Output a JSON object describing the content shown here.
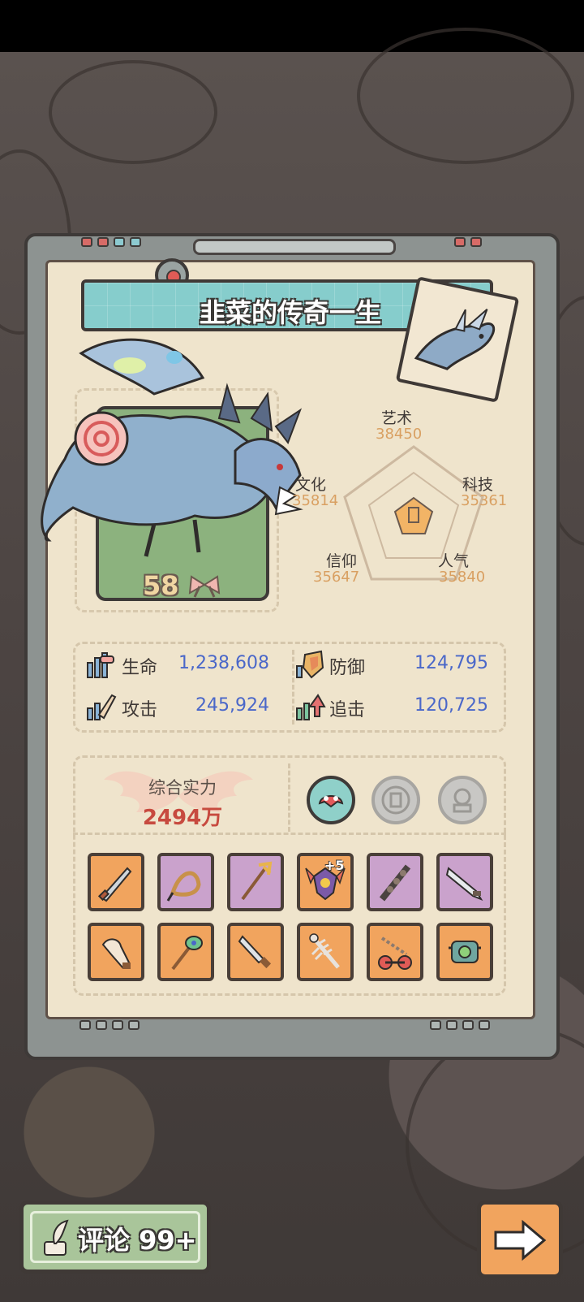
{
  "header": {
    "title": "韭菜的传奇一生"
  },
  "creature": {
    "level": "58"
  },
  "radar": {
    "stats": [
      {
        "key": "art",
        "name": "艺术",
        "value": "38450"
      },
      {
        "key": "tech",
        "name": "科技",
        "value": "35361"
      },
      {
        "key": "popularity",
        "name": "人气",
        "value": "35840"
      },
      {
        "key": "faith",
        "name": "信仰",
        "value": "35647"
      },
      {
        "key": "culture",
        "name": "文化",
        "value": "35814"
      }
    ]
  },
  "stats": {
    "hp": {
      "label": "生命",
      "value": "1,238,608"
    },
    "defense": {
      "label": "防御",
      "value": "124,795"
    },
    "attack": {
      "label": "攻击",
      "value": "245,924"
    },
    "pursuit": {
      "label": "追击",
      "value": "120,725"
    }
  },
  "power": {
    "label": "综合实力",
    "value": "2494万"
  },
  "equipment": {
    "enhance_badge": "+5"
  },
  "buttons": {
    "comment_label": "评论 99+"
  },
  "colors": {
    "orange_slot": "#f1a45e",
    "purple_slot": "#caa2cc",
    "stat_value_blue": "#4a67c9",
    "radar_value": "#d9a062"
  }
}
